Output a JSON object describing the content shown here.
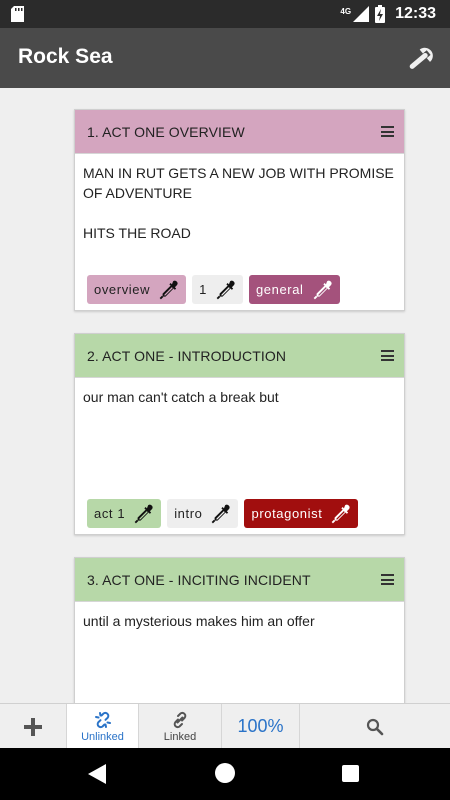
{
  "status_bar": {
    "network": "4G",
    "time": "12:33"
  },
  "app": {
    "title": "Rock Sea"
  },
  "colors": {
    "pink_header": "#d4a5bf",
    "green_header": "#b7d8a8",
    "tag_overview": "#d4a5bf",
    "tag_general": "#a4527c",
    "tag_act1": "#b7d8a8",
    "tag_neutral": "#eeeeee",
    "tag_protagonist": "#a10e0e",
    "accent": "#2a73c8"
  },
  "cards": [
    {
      "title": "1. ACT ONE OVERVIEW",
      "body": "MAN IN RUT GETS A NEW JOB WITH PROMISE OF ADVENTURE\n\nHITS THE ROAD",
      "tags": [
        {
          "label": "overview"
        },
        {
          "label": "1"
        },
        {
          "label": "general"
        }
      ]
    },
    {
      "title": "2. ACT ONE - INTRODUCTION",
      "body": "our man can't catch a break but",
      "tags": [
        {
          "label": "act 1"
        },
        {
          "label": "intro"
        },
        {
          "label": "protagonist"
        }
      ]
    },
    {
      "title": "3. ACT ONE - INCITING INCIDENT",
      "body": "until a mysterious makes him an offer",
      "tags": []
    }
  ],
  "bottom_bar": {
    "add_icon": "plus-icon",
    "unlinked_label": "Unlinked",
    "linked_label": "Linked",
    "zoom": "100%",
    "search_icon": "search-icon"
  }
}
